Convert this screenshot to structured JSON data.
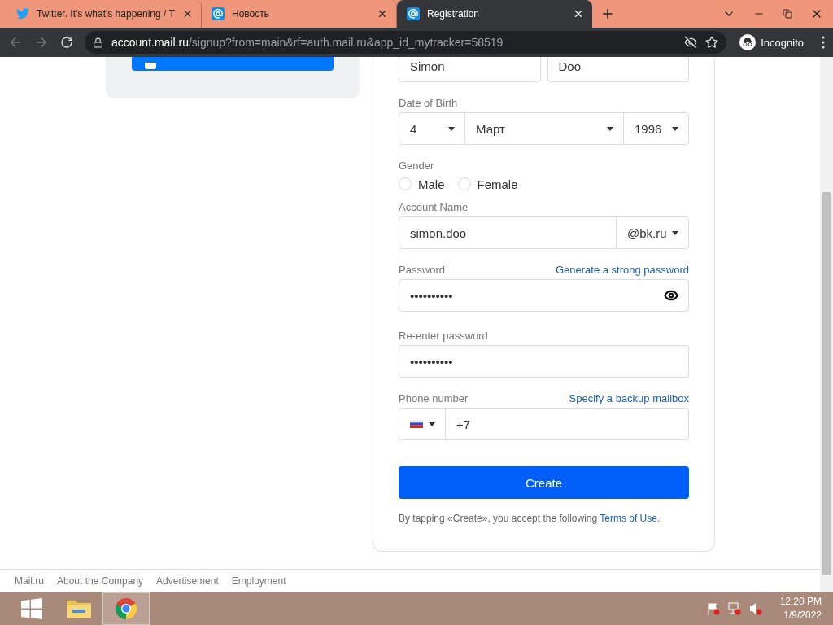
{
  "browser": {
    "tabs": [
      {
        "title": "Twitter. It's what's happening / T",
        "kind": "twitter",
        "selected": false
      },
      {
        "title": "Новость",
        "kind": "mail",
        "selected": false
      },
      {
        "title": "Registration",
        "kind": "mail",
        "selected": true
      }
    ],
    "address": {
      "host": "account.mail.ru",
      "path": "/signup?from=main&rf=auth.mail.ru&app_id_mytracker=58519"
    },
    "profile": "Incognito"
  },
  "form": {
    "first_name": "Simon",
    "last_name": "Doo",
    "birth": {
      "label": "Date of Birth",
      "day": "4",
      "month": "Март",
      "year": "1996"
    },
    "gender": {
      "label": "Gender",
      "options": [
        {
          "label": "Male",
          "selected": false
        },
        {
          "label": "Female",
          "selected": false
        }
      ]
    },
    "account": {
      "label": "Account Name",
      "value": "simon.doo",
      "domain": "@bk.ru"
    },
    "password": {
      "label": "Password",
      "link": "Generate a strong password",
      "value": "••••••••••"
    },
    "repeat": {
      "label": "Re-enter password",
      "value": "••••••••••"
    },
    "phone": {
      "label": "Phone number",
      "link": "Specify a backup mailbox",
      "value": "+7"
    },
    "submit": "Create",
    "terms": {
      "before": "By tapping «Create», you accept the following",
      "link": "Terms of Use",
      "after": "."
    }
  },
  "footer": [
    "Mail.ru",
    "About the Company",
    "Advertisement",
    "Employment"
  ],
  "taskbar": {
    "time": "12:20 PM",
    "date": "1/9/2022"
  }
}
